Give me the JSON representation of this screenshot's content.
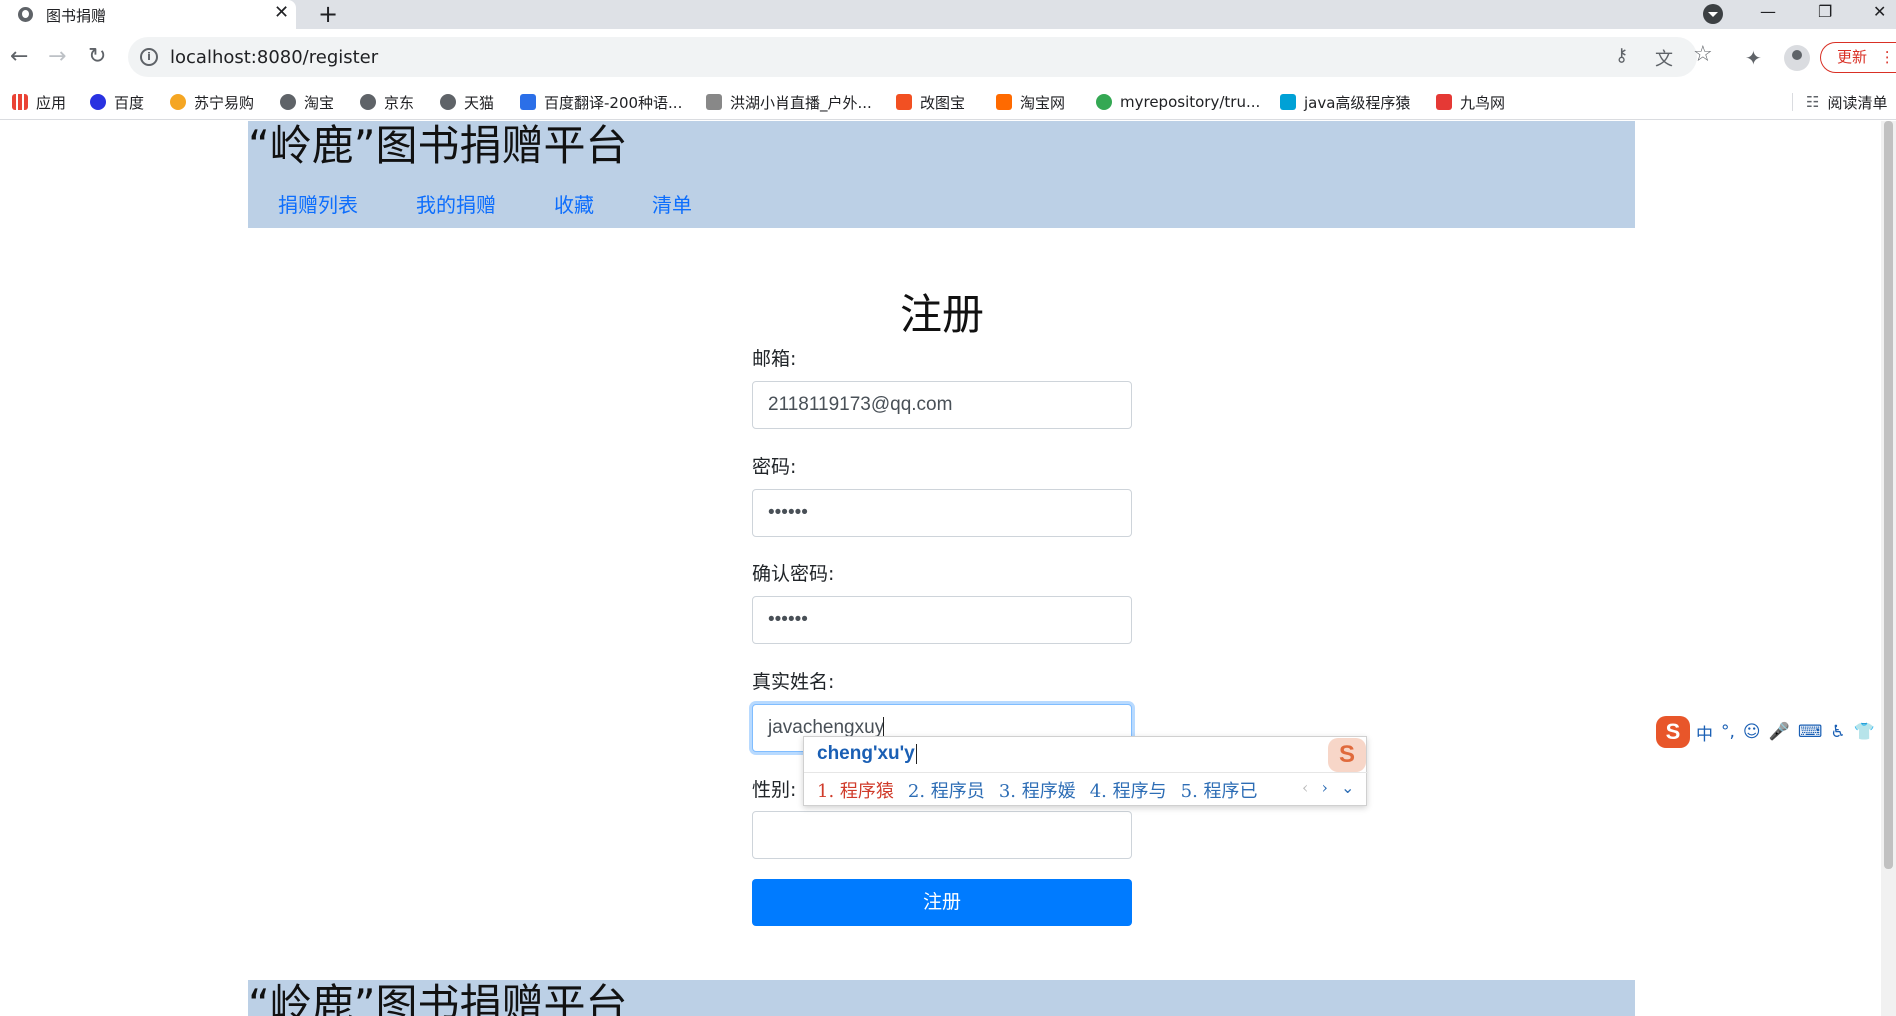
{
  "browser": {
    "tab_title": "图书捐赠",
    "tab_close": "✕",
    "new_tab": "+",
    "url": "localhost:8080/register",
    "update_label": "更新",
    "nav": {
      "back": "←",
      "forward": "→",
      "reload": "↻"
    },
    "window": {
      "minimize": "—",
      "maximize": "❐",
      "close": "✕"
    },
    "omnibox_icons": {
      "key": "⚷",
      "translate": "文",
      "star": "☆"
    },
    "extensions_icon": "✦",
    "more_icon": "⋮",
    "bookmarks": [
      {
        "label": "应用",
        "color": "#4285f4"
      },
      {
        "label": "百度",
        "color": "#2932e1"
      },
      {
        "label": "苏宁易购",
        "color": "#f5a623"
      },
      {
        "label": "淘宝",
        "color": "#5f6368"
      },
      {
        "label": "京东",
        "color": "#5f6368"
      },
      {
        "label": "天猫",
        "color": "#5f6368"
      },
      {
        "label": "百度翻译-200种语...",
        "color": "#2b6fe8"
      },
      {
        "label": "洪湖小肖直播_户外...",
        "color": "#888888"
      },
      {
        "label": "改图宝",
        "color": "#f25022"
      },
      {
        "label": "淘宝网",
        "color": "#ff6a00"
      },
      {
        "label": "myrepository/tru...",
        "color": "#34a853"
      },
      {
        "label": "java高级程序猿",
        "color": "#00a1d6"
      },
      {
        "label": "九鸟网",
        "color": "#e53935"
      }
    ],
    "reading_list": "阅读清单",
    "reading_list_icon": "☷"
  },
  "site": {
    "title": "“岭鹿”图书捐赠平台",
    "nav": [
      "捐赠列表",
      "我的捐赠",
      "收藏",
      "清单"
    ]
  },
  "form": {
    "title": "注册",
    "email_label": "邮箱:",
    "email_value": "2118119173@qq.com",
    "password_label": "密码:",
    "password_value": "••••••",
    "confirm_label": "确认密码:",
    "confirm_value": "••••••",
    "realname_label": "真实姓名:",
    "realname_value": "javachengxuy",
    "gender_label": "性别:",
    "gender_value": "",
    "submit_label": "注册"
  },
  "footer": {
    "title": "“岭鹿”图书捐赠平台"
  },
  "ime": {
    "pinyin": "cheng'xu'y",
    "candidates": [
      "1. 程序猿",
      "2. 程序员",
      "3. 程序媛",
      "4. 程序与",
      "5. 程序已"
    ],
    "prev": "‹",
    "next": "›",
    "expand": "⌄",
    "logo": "S",
    "toolbar": [
      "中",
      "°,",
      "☺",
      "🎤",
      "⌨",
      "♿",
      "👕"
    ]
  }
}
